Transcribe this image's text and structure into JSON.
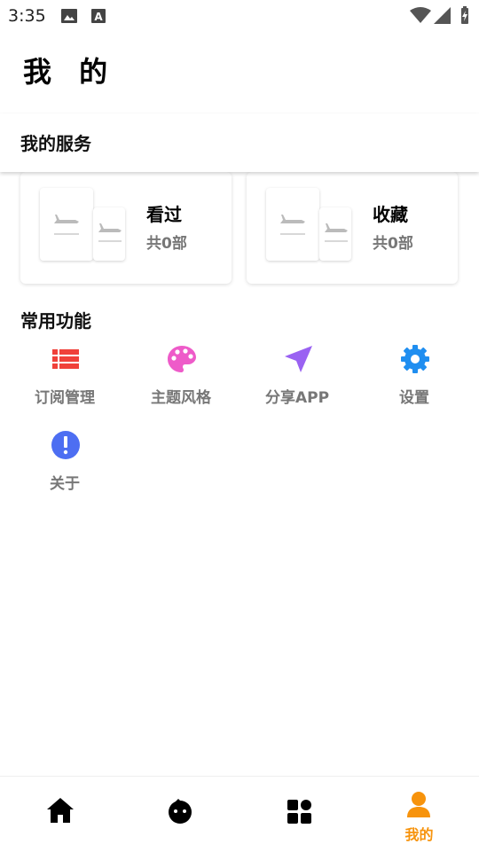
{
  "status_bar": {
    "time": "3:35",
    "left_icons": [
      "image-icon",
      "text-a-icon"
    ],
    "right_icons": [
      "wifi-icon",
      "signal-icon",
      "battery-charging-icon"
    ]
  },
  "page_title": "我 的",
  "services": {
    "header": "我的服务",
    "cards": [
      {
        "title": "看过",
        "count": "共0部",
        "icon": "airplane-icon"
      },
      {
        "title": "收藏",
        "count": "共0部",
        "icon": "airplane-icon"
      }
    ]
  },
  "functions": {
    "header": "常用功能",
    "items": [
      {
        "label": "订阅管理",
        "icon": "list-icon",
        "color": "#f0413a"
      },
      {
        "label": "主题风格",
        "icon": "palette-icon",
        "color": "#ee5bc9"
      },
      {
        "label": "分享APP",
        "icon": "send-icon",
        "color": "#9a62f2"
      },
      {
        "label": "设置",
        "icon": "gear-icon",
        "color": "#1f8ef0"
      },
      {
        "label": "关于",
        "icon": "info-icon",
        "color": "#4d6ef2"
      }
    ]
  },
  "bottom_nav": {
    "items": [
      {
        "name": "home",
        "icon": "home-icon",
        "label": ""
      },
      {
        "name": "discover",
        "icon": "face-icon",
        "label": ""
      },
      {
        "name": "category",
        "icon": "grid-icon",
        "label": ""
      },
      {
        "name": "mine",
        "icon": "person-icon",
        "label": "我的",
        "active": true
      }
    ],
    "active_color": "#f7930c"
  }
}
